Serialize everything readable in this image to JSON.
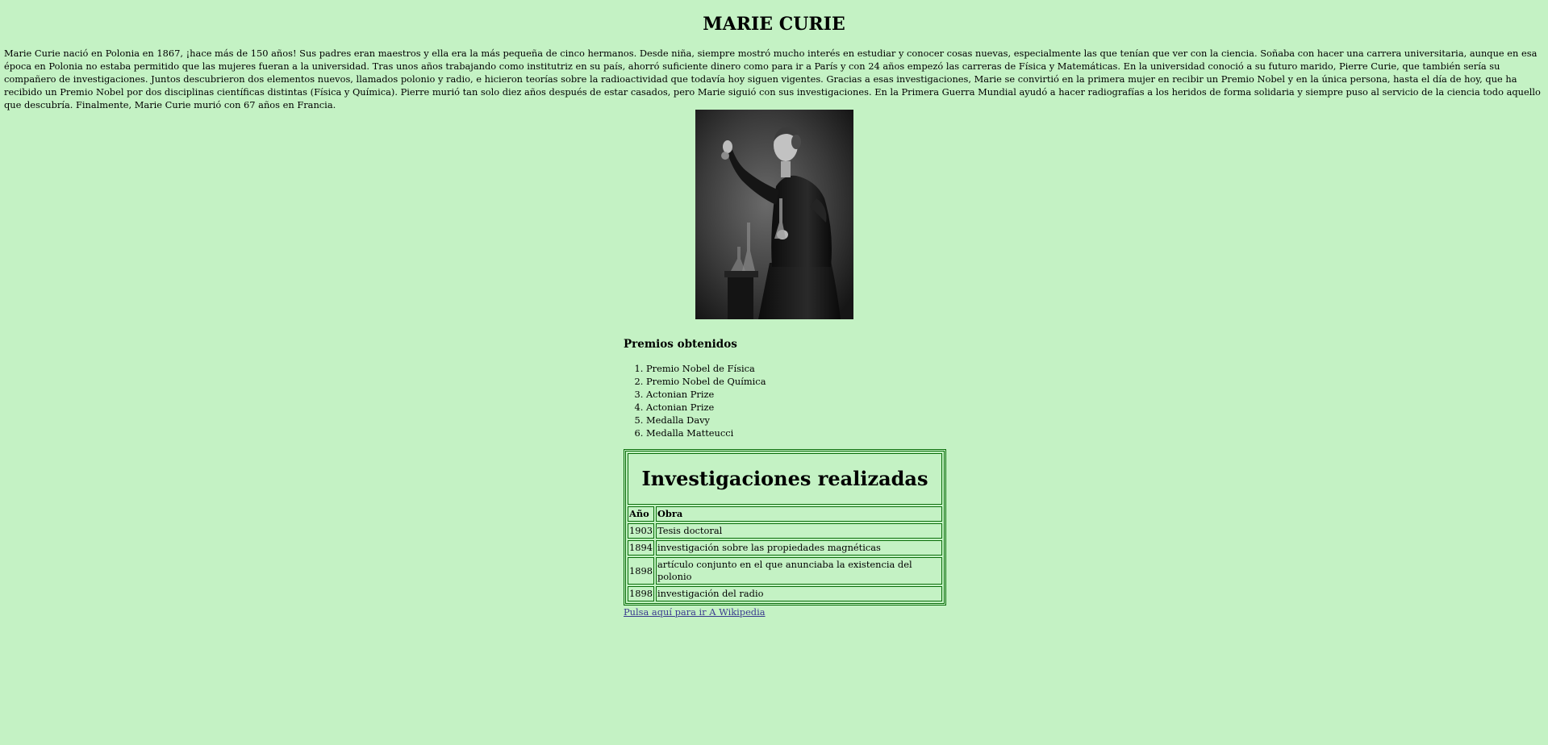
{
  "page": {
    "title": "MARIE CURIE",
    "intro": "Marie Curie nació en Polonia en 1867, ¡hace más de 150 años! Sus padres eran maestros y ella era la más pequeña de cinco hermanos. Desde niña, siempre mostró mucho interés en estudiar y conocer cosas nuevas, especialmente las que tenían que ver con la ciencia. Soñaba con hacer una carrera universitaria, aunque en esa época en Polonia no estaba permitido que las mujeres fueran a la universidad. Tras unos años trabajando como institutriz en su país, ahorró suficiente dinero como para ir a París y con 24 años empezó las carreras de Física y Matemáticas. En la universidad conoció a su futuro marido, Pierre Curie, que también sería su compañero de investigaciones. Juntos descubrieron dos elementos nuevos, llamados polonio y radio, e hicieron teorías sobre la radioactividad que todavía hoy siguen vigentes. Gracias a esas investigaciones, Marie se convirtió en la primera mujer en recibir un Premio Nobel y en la única persona, hasta el día de hoy, que ha recibido un Premio Nobel por dos disciplinas científicas distintas (Física y Química). Pierre murió tan solo diez años después de estar casados, pero Marie siguió con sus investigaciones. En la Primera Guerra Mundial ayudó a hacer radiografías a los heridos de forma solidaria y siempre puso al servicio de la ciencia todo aquello que descubría. Finalmente, Marie Curie murió con 67 años en Francia."
  },
  "awards": {
    "heading": "Premios obtenidos",
    "items": [
      "Premio Nobel de Física",
      "Premio Nobel de Química",
      "Actonian Prize",
      "Actonian Prize",
      "Medalla Davy",
      "Medalla Matteucci"
    ]
  },
  "research": {
    "title": "Investigaciones realizadas",
    "headers": [
      "Año",
      "Obra"
    ],
    "rows": [
      [
        "1903",
        "Tesis doctoral"
      ],
      [
        "1894",
        "investigación sobre las propiedades magnéticas"
      ],
      [
        "1898",
        "artículo conjunto en el que anunciaba la existencia del polonio"
      ],
      [
        "1898",
        "investigación del radio"
      ]
    ]
  },
  "link": {
    "label": "Pulsa aquí para ir A Wikipedia"
  },
  "colors": {
    "background": "#c4f2c4",
    "table_border": "#0a6e0a",
    "link": "#3b3b8f"
  }
}
